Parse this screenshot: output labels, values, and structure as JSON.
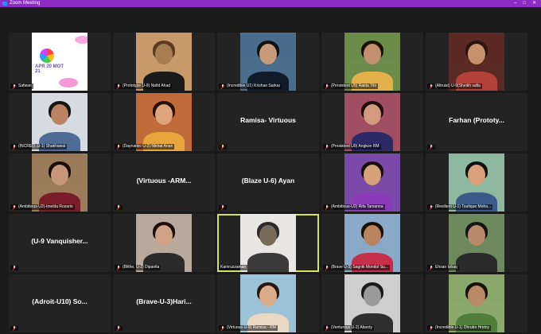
{
  "window": {
    "title": "Zoom Meeting",
    "controls": [
      "–",
      "□",
      "✕"
    ]
  },
  "colors": {
    "titlebar": "#8e2bc4",
    "speaking_border": "#d6e35a",
    "muted_mic": "#e0252b"
  },
  "logo": {
    "text": "APR 20 MOT 21"
  },
  "tiles": [
    {
      "name": "Safwan",
      "kind": "logo",
      "muted": true
    },
    {
      "name": "(Prototype U-9) Nafid Ahad",
      "kind": "video",
      "muted": true,
      "palette": [
        "#c89a6a",
        "#a97d52",
        "#5a3b22",
        "#1a1a1a"
      ]
    },
    {
      "name": "(Incredible U1) Krishan Sarkar",
      "kind": "video",
      "muted": true,
      "palette": [
        "#4a6d8c",
        "#c79a7b",
        "#111111",
        "#0f1a2a"
      ]
    },
    {
      "name": "(Persistent U9) Raida Titir",
      "kind": "video",
      "muted": true,
      "palette": [
        "#6b8c4a",
        "#c48f6e",
        "#1a1108",
        "#e3b04a"
      ]
    },
    {
      "name": "(Altruist) U-9(Sheikh safia",
      "kind": "video",
      "muted": true,
      "palette": [
        "#5a2a24",
        "#c8916e",
        "#2a1510",
        "#b5413b"
      ]
    },
    {
      "name": "(INCRED..U-1) Shakhawat",
      "kind": "video",
      "muted": true,
      "palette": [
        "#d5dbe0",
        "#b88263",
        "#151515",
        "#4f6c97"
      ]
    },
    {
      "name": "(Daynamic U-2) Nikhat Anan",
      "kind": "video",
      "muted": true,
      "palette": [
        "#c26b3a",
        "#e0a47d",
        "#2a1108",
        "#e7a63c"
      ]
    },
    {
      "name": "Ramisa- Virtuous",
      "kind": "name",
      "muted": true
    },
    {
      "name": "(Persistent U9) Angkon RM",
      "kind": "video",
      "muted": true,
      "palette": [
        "#a04f63",
        "#d49a7e",
        "#1f0f0a",
        "#2c2a66"
      ]
    },
    {
      "name": "Farhan (Prototy...",
      "kind": "name",
      "muted": true
    },
    {
      "name": "(Ambitious-U2)-Imelda Rozario",
      "kind": "video",
      "muted": true,
      "palette": [
        "#9a7c5a",
        "#c7957a",
        "#1a0e08",
        "#7a1d2a"
      ]
    },
    {
      "name": "(Virtuous -ARM...",
      "kind": "name",
      "muted": true
    },
    {
      "name": "(Blaze U-6) Ayan",
      "kind": "name",
      "muted": true
    },
    {
      "name": "(Ambitious-U2) Rifa Tamanna",
      "kind": "video",
      "muted": true,
      "palette": [
        "#7b4aa8",
        "#d5a07a",
        "#1a0c08",
        "#8a3ab8"
      ]
    },
    {
      "name": "(Resilient U-1) Toufique Moha...",
      "kind": "video",
      "muted": true,
      "palette": [
        "#8fb8a0",
        "#d9a07c",
        "#111111",
        "#3a5a8a"
      ]
    },
    {
      "name": "(U-9 Vanquisher...",
      "kind": "name",
      "muted": true
    },
    {
      "name": "(Blithe, U-2) Dipanita",
      "kind": "video",
      "muted": true,
      "palette": [
        "#b9a89c",
        "#d2a287",
        "#1a0f0a",
        "#2a2a2a"
      ]
    },
    {
      "name": "Kamruzzaman",
      "kind": "video",
      "muted": false,
      "speaking": true,
      "palette": [
        "#e8e6e2",
        "#7a6a5a",
        "#2a2a2a",
        "#3a3a3a"
      ]
    },
    {
      "name": "(Brave U-3) Sagnik Mondol Su...",
      "kind": "video",
      "muted": true,
      "palette": [
        "#8aa9c8",
        "#b9835f",
        "#1a1008",
        "#c4304a"
      ]
    },
    {
      "name": "Ehsan Ishaq",
      "kind": "video",
      "muted": true,
      "palette": [
        "#6d8a5e",
        "#b98a6a",
        "#151515",
        "#2a2a2a"
      ]
    },
    {
      "name": "(Adroit-U10) So...",
      "kind": "name",
      "muted": true
    },
    {
      "name": "(Brave-U-3)Hari...",
      "kind": "name",
      "muted": true
    },
    {
      "name": "(Virtuous-U-9) Ramisa - RM",
      "kind": "video",
      "muted": true,
      "palette": [
        "#9cc2d8",
        "#d9ac8a",
        "#2a1810",
        "#e9d9c4"
      ]
    },
    {
      "name": "(Venturous U-2) Abonty",
      "kind": "video",
      "muted": true,
      "palette": [
        "#cfcfcf",
        "#9a9a9a",
        "#1a1a1a",
        "#2f2f2f"
      ]
    },
    {
      "name": "(Incredible U-1) Dhrubo Hridoy",
      "kind": "video",
      "muted": true,
      "palette": [
        "#8aa96a",
        "#b98a66",
        "#1a1008",
        "#4f7f3a"
      ]
    }
  ]
}
